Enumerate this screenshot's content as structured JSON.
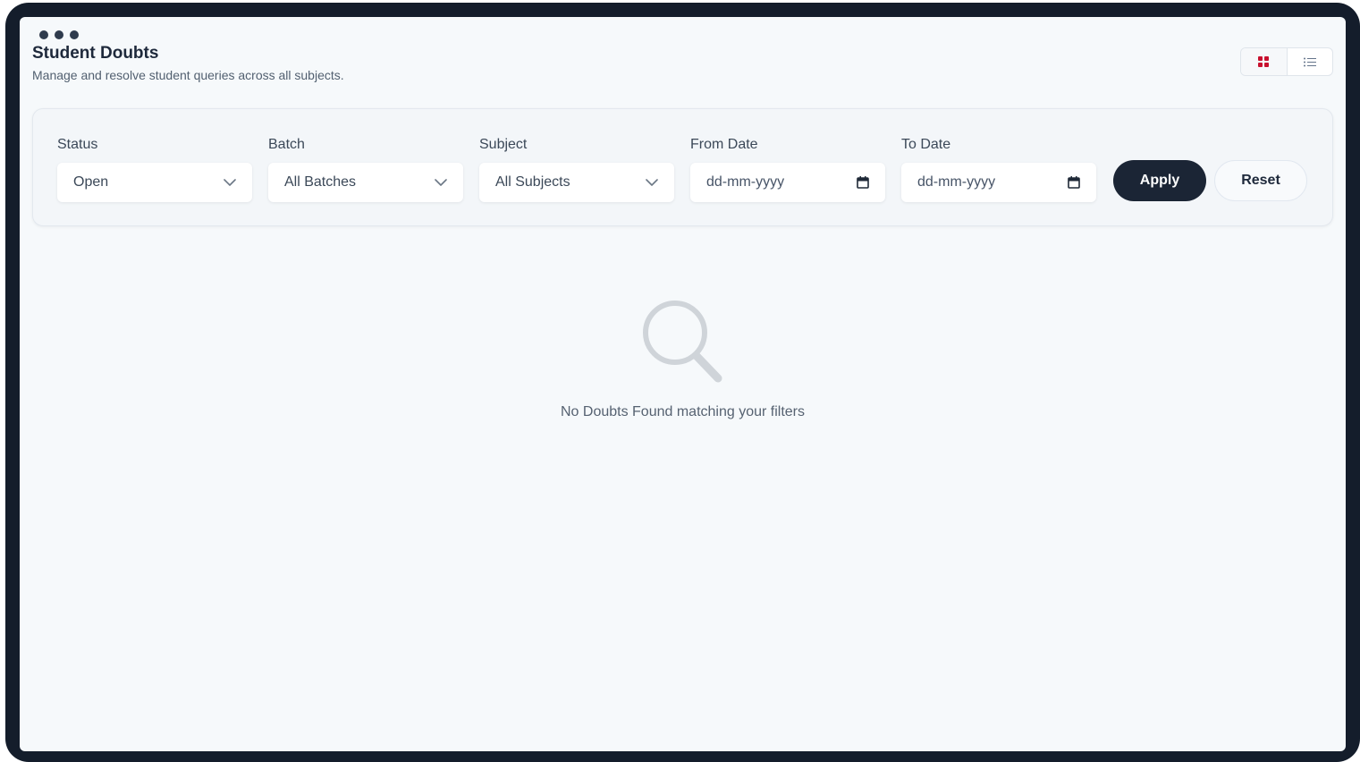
{
  "header": {
    "title": "Student Doubts",
    "subtitle": "Manage and resolve student queries across all subjects."
  },
  "view_toggle": {
    "active": "grid",
    "accent_color": "#c8102e"
  },
  "filters": {
    "status": {
      "label": "Status",
      "value": "Open"
    },
    "batch": {
      "label": "Batch",
      "value": "All Batches"
    },
    "subject": {
      "label": "Subject",
      "value": "All Subjects"
    },
    "from_date": {
      "label": "From Date",
      "placeholder": "dd-mm-yyyy"
    },
    "to_date": {
      "label": "To Date",
      "placeholder": "dd-mm-yyyy"
    },
    "apply_label": "Apply",
    "reset_label": "Reset"
  },
  "empty_state": {
    "icon": "search-icon",
    "message": "No Doubts Found matching your filters"
  }
}
